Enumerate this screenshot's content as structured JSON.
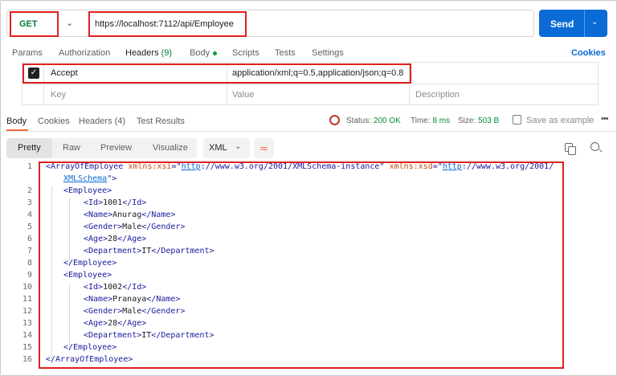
{
  "request": {
    "method": "GET",
    "url": "https://localhost:7112/api/Employee",
    "send_label": "Send"
  },
  "request_tabs": [
    {
      "label": "Params"
    },
    {
      "label": "Authorization"
    },
    {
      "label": "Headers",
      "count": "(9)"
    },
    {
      "label": "Body"
    },
    {
      "label": "Scripts"
    },
    {
      "label": "Tests"
    },
    {
      "label": "Settings"
    }
  ],
  "cookies_link": "Cookies",
  "headers_table": {
    "rows": [
      {
        "key": "Accept",
        "value": "application/xml;q=0.5,application/json;q=0.8",
        "checked": true
      }
    ],
    "placeholder": {
      "key": "Key",
      "value": "Value",
      "description": "Description"
    }
  },
  "response": {
    "tabs": [
      {
        "label": "Body"
      },
      {
        "label": "Cookies"
      },
      {
        "label": "Headers",
        "count": "(4)"
      },
      {
        "label": "Test Results"
      }
    ],
    "status_label": "Status:",
    "status_value": "200 OK",
    "time_label": "Time:",
    "time_value": "8 ms",
    "size_label": "Size:",
    "size_value": "503 B",
    "save_example": "Save as example",
    "view_modes": [
      "Pretty",
      "Raw",
      "Preview",
      "Visualize"
    ],
    "format": "XML"
  },
  "code_lines": [
    {
      "n": "1",
      "text": "<ArrayOfEmployee xmlns:xsi=\"http://www.w3.org/2001/XMLSchema-instance\" xmlns:xsd=\"http://www.w3.org/2001/"
    },
    {
      "n": "",
      "text": "XMLSchema\">"
    },
    {
      "n": "2",
      "text": "<Employee>"
    },
    {
      "n": "3",
      "text": "<Id>1001</Id>"
    },
    {
      "n": "4",
      "text": "<Name>Anurag</Name>"
    },
    {
      "n": "5",
      "text": "<Gender>Male</Gender>"
    },
    {
      "n": "6",
      "text": "<Age>28</Age>"
    },
    {
      "n": "7",
      "text": "<Department>IT</Department>"
    },
    {
      "n": "8",
      "text": "</Employee>"
    },
    {
      "n": "9",
      "text": "<Employee>"
    },
    {
      "n": "10",
      "text": "<Id>1002</Id>"
    },
    {
      "n": "11",
      "text": "<Name>Pranaya</Name>"
    },
    {
      "n": "12",
      "text": "<Gender>Male</Gender>"
    },
    {
      "n": "13",
      "text": "<Age>28</Age>"
    },
    {
      "n": "14",
      "text": "<Department>IT</Department>"
    },
    {
      "n": "15",
      "text": "</Employee>"
    },
    {
      "n": "16",
      "text": "</ArrayOfEmployee>"
    }
  ],
  "colors": {
    "accent": "#f26b3a",
    "send": "#0b6bd6",
    "method": "#0b7a3b",
    "highlight": "#e02020"
  }
}
